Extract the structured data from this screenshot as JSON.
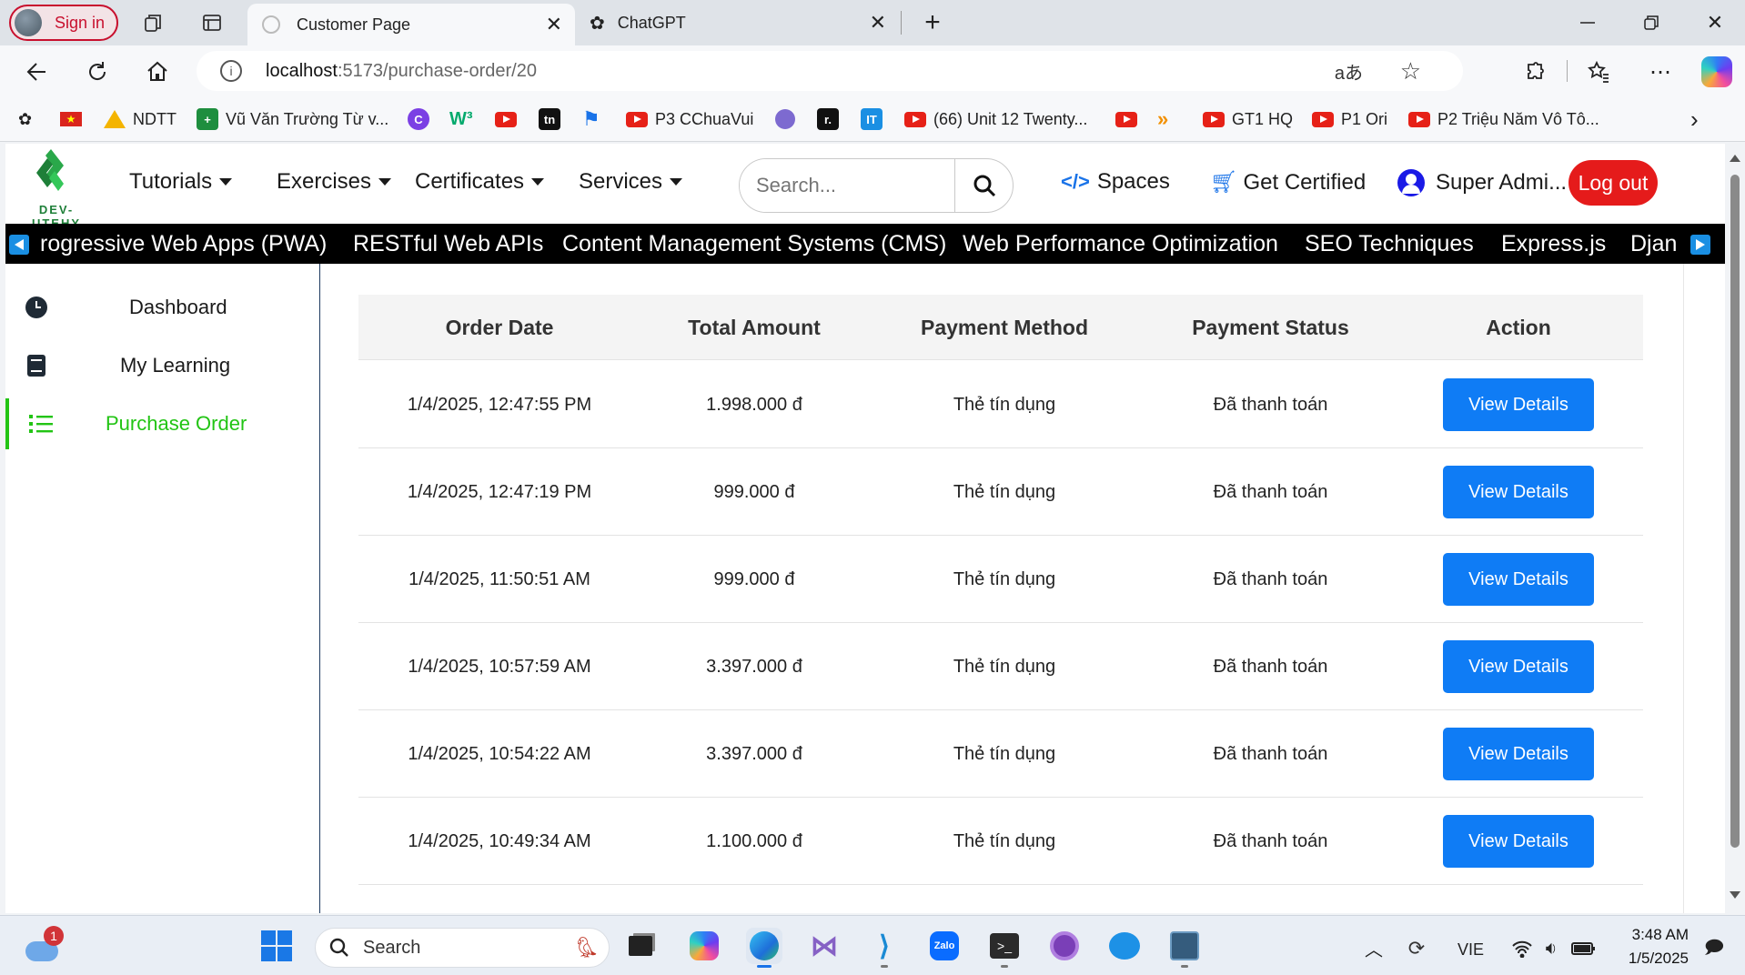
{
  "browser": {
    "sign_in": "Sign in",
    "tabs": [
      {
        "title": "Customer Page",
        "active": true
      },
      {
        "title": "ChatGPT",
        "active": false
      }
    ],
    "url_host": "localhost",
    "url_path": ":5173/purchase-order/20",
    "bookmarks": {
      "ndtt": "NDTT",
      "vu_van": "Vũ Văn Trường Từ v...",
      "p3": "P3 CChuaVui",
      "unit12": "(66) Unit 12 Twenty...",
      "gt1": "GT1 HQ",
      "p1": "P1 Ori",
      "p2": "P2 Triệu Năm Vô Tô..."
    }
  },
  "site": {
    "logo_text": "DEV-UTEHY",
    "nav": {
      "tutorials": "Tutorials",
      "exercises": "Exercises",
      "certificates": "Certificates",
      "services": "Services"
    },
    "search_placeholder": "Search...",
    "spaces": "Spaces",
    "get_certified": "Get Certified",
    "user": "Super Admi...",
    "logout": "Log out",
    "ticker": [
      "rogressive Web Apps (PWA)",
      "RESTful Web APIs",
      "Content Management Systems (CMS)",
      "Web Performance Optimization",
      "SEO Techniques",
      "Express.js",
      "Djan"
    ]
  },
  "sidebar": {
    "items": [
      {
        "label": "Dashboard",
        "icon": "clock-icon"
      },
      {
        "label": "My Learning",
        "icon": "book-icon"
      },
      {
        "label": "Purchase Order",
        "icon": "list-icon",
        "active": true
      }
    ]
  },
  "table": {
    "headers": {
      "date": "Order Date",
      "amount": "Total Amount",
      "method": "Payment Method",
      "status": "Payment Status",
      "action": "Action"
    },
    "rows": [
      {
        "date": "1/4/2025, 12:47:55 PM",
        "amount": "1.998.000 đ",
        "method": "Thẻ tín dụng",
        "status": "Đã thanh toán",
        "action": "View Details"
      },
      {
        "date": "1/4/2025, 12:47:19 PM",
        "amount": "999.000 đ",
        "method": "Thẻ tín dụng",
        "status": "Đã thanh toán",
        "action": "View Details"
      },
      {
        "date": "1/4/2025, 11:50:51 AM",
        "amount": "999.000 đ",
        "method": "Thẻ tín dụng",
        "status": "Đã thanh toán",
        "action": "View Details"
      },
      {
        "date": "1/4/2025, 10:57:59 AM",
        "amount": "3.397.000 đ",
        "method": "Thẻ tín dụng",
        "status": "Đã thanh toán",
        "action": "View Details"
      },
      {
        "date": "1/4/2025, 10:54:22 AM",
        "amount": "3.397.000 đ",
        "method": "Thẻ tín dụng",
        "status": "Đã thanh toán",
        "action": "View Details"
      },
      {
        "date": "1/4/2025, 10:49:34 AM",
        "amount": "1.100.000 đ",
        "method": "Thẻ tín dụng",
        "status": "Đã thanh toán",
        "action": "View Details"
      }
    ]
  },
  "taskbar": {
    "search": "Search",
    "lang": "VIE",
    "time": "3:48 AM",
    "date": "1/5/2025",
    "weather_badge": "1"
  },
  "colors": {
    "accent_green": "#22c414",
    "button_blue": "#0f7cf5",
    "logout_red": "#e51b1b"
  }
}
